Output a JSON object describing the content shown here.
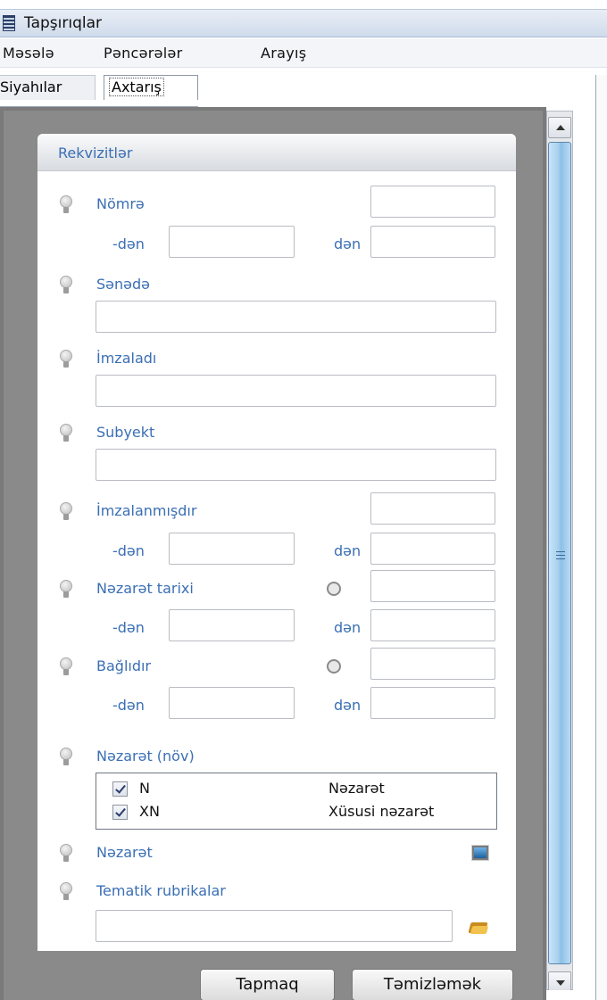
{
  "window": {
    "title": "Tapşırıqlar"
  },
  "menu": [
    "Məsələ",
    "Pəncərələr",
    "Arayış"
  ],
  "tabs": {
    "lists": "Siyahılar",
    "search": "Axtarış"
  },
  "panel": {
    "header": "Rekvizitlər"
  },
  "fields": {
    "number": "Nömrə",
    "document": "Sənədə",
    "signed_by": "İmzaladı",
    "subject": "Subyekt",
    "signed_date": "İmzalanmışdır",
    "control_date": "Nəzarət tarixi",
    "closed": "Bağlıdır",
    "control_type": "Nəzarət (növ)",
    "control": "Nəzarət",
    "thematic_rubrics": "Tematik rubrikalar"
  },
  "range": {
    "from": "-dən",
    "to": "dən"
  },
  "control_types": [
    {
      "code": "N",
      "name": "Nəzarət",
      "checked": true
    },
    {
      "code": "XN",
      "name": "Xüsusi nəzarət",
      "checked": true
    }
  ],
  "buttons": {
    "find": "Tapmaq",
    "clear": "Təmizləmək"
  }
}
